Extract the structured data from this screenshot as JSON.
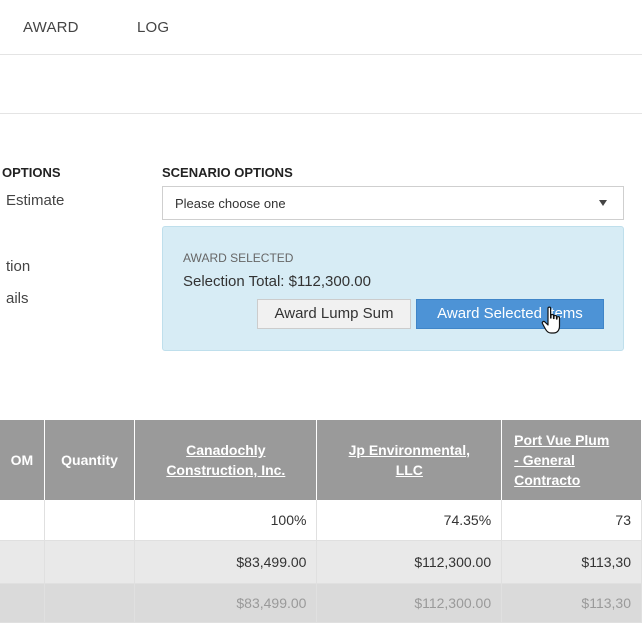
{
  "tabs": {
    "award": "AWARD",
    "log": "LOG"
  },
  "options": {
    "heading": "OPTIONS",
    "items": [
      "Estimate",
      "tion",
      "ails"
    ]
  },
  "scenario": {
    "heading": "SCENARIO OPTIONS",
    "selected": "Please choose one"
  },
  "award_panel": {
    "label": "AWARD SELECTED",
    "total": "Selection Total: $112,300.00",
    "lump_sum_button": "Award Lump Sum",
    "selected_button": "Award Selected Items"
  },
  "table": {
    "headers": {
      "uom": "OM",
      "quantity": "Quantity",
      "suppliers": [
        {
          "line1": "Canadochly",
          "line2": "Construction, Inc.",
          "line3": ""
        },
        {
          "line1": "Jp Environmental,",
          "line2": "LLC",
          "line3": ""
        },
        {
          "line1": "Port Vue Plum",
          "line2": "- General",
          "line3": "Contracto"
        }
      ]
    },
    "rows": [
      {
        "uom": "",
        "quantity": "",
        "values": [
          "100%",
          "74.35%",
          "73"
        ]
      },
      {
        "uom": "",
        "quantity": "",
        "values": [
          "$83,499.00",
          "$112,300.00",
          "$113,30"
        ]
      },
      {
        "uom": "",
        "quantity": "",
        "values": [
          "$83,499.00",
          "$112,300.00",
          "$113,30"
        ]
      }
    ]
  },
  "colors": {
    "award_panel_bg": "#d7ecf5",
    "primary_button": "#4d93d6",
    "table_header_bg": "#9a9a9a"
  }
}
